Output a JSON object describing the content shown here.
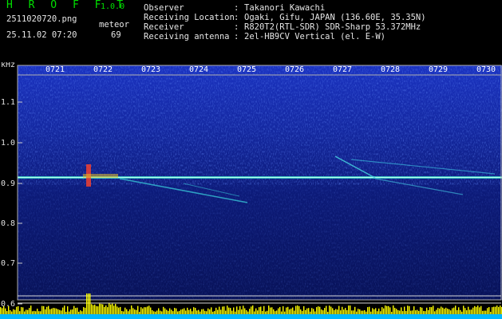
{
  "header": {
    "app_title": "H R O F F T",
    "app_version": "1.0.0",
    "filename": "2511020720.png",
    "datetime": "25.11.02 07:20",
    "mode_label": "meteor",
    "meteor_count": "69"
  },
  "info": [
    {
      "key": "Observer",
      "value": "Takanori Kawachi"
    },
    {
      "key": "Receiving Location",
      "value": "Ogaki, Gifu, JAPAN (136.60E, 35.35N)"
    },
    {
      "key": "Receiver",
      "value": "R820T2(RTL-SDR) SDR-Sharp 53.372MHz"
    },
    {
      "key": "Receiving antenna",
      "value": "2el-HB9CV Vertical (el. E-W)"
    }
  ],
  "separator": ":",
  "axis": {
    "y_unit": "kHz",
    "freq_ticks": [
      "1.1",
      "1.0",
      "0.9",
      "0.8",
      "0.7",
      "0.6"
    ],
    "time_ticks": [
      "0721",
      "0722",
      "0723",
      "0724",
      "0725",
      "0726",
      "0727",
      "0728",
      "0729",
      "0730"
    ]
  },
  "colors": {
    "background": "#000000",
    "noise_high": "#1c35c8",
    "noise_low": "#0a1460",
    "carrier": "#3fd0c8",
    "text_green": "#00e000",
    "level_bar": "#ffff00",
    "level_base": "#00b8ff"
  }
}
